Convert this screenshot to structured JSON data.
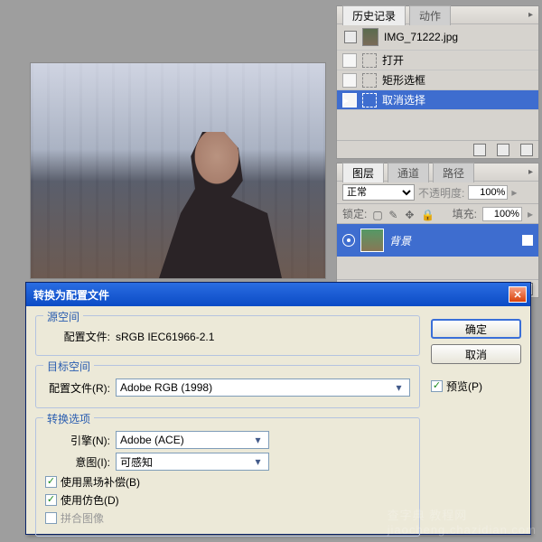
{
  "history_panel": {
    "tabs": [
      "历史记录",
      "动作"
    ],
    "doc_name": "IMG_71222.jpg",
    "items": [
      {
        "label": "打开"
      },
      {
        "label": "矩形选框"
      },
      {
        "label": "取消选择",
        "selected": true
      }
    ]
  },
  "layers_panel": {
    "tabs": [
      "图层",
      "通道",
      "路径"
    ],
    "blend_mode": "正常",
    "opacity_label": "不透明度:",
    "opacity_value": "100%",
    "lock_label": "锁定:",
    "fill_label": "填充:",
    "fill_value": "100%",
    "layer_name": "背景"
  },
  "dialog": {
    "title": "转换为配置文件",
    "source_group": "源空间",
    "source_profile_label": "配置文件:",
    "source_profile_value": "sRGB IEC61966-2.1",
    "dest_group": "目标空间",
    "dest_profile_label": "配置文件(R):",
    "dest_profile_value": "Adobe RGB (1998)",
    "options_group": "转换选项",
    "engine_label": "引擎(N):",
    "engine_value": "Adobe (ACE)",
    "intent_label": "意图(I):",
    "intent_value": "可感知",
    "blackpoint_label": "使用黑场补偿(B)",
    "dither_label": "使用仿色(D)",
    "flatten_label": "拼合图像",
    "ok": "确定",
    "cancel": "取消",
    "preview": "预览(P)"
  }
}
